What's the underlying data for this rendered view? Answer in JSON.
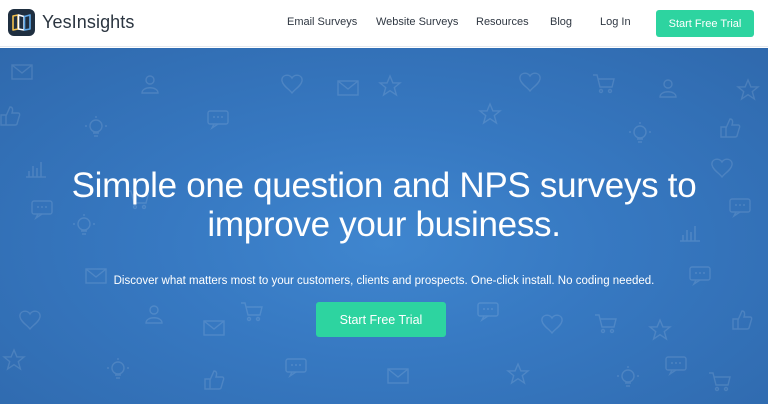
{
  "brand": {
    "name": "YesInsights",
    "logo_icon": "book-map-icon"
  },
  "nav": {
    "links": [
      {
        "label": "Email Surveys"
      },
      {
        "label": "Website Surveys"
      },
      {
        "label": "Resources"
      },
      {
        "label": "Blog"
      },
      {
        "label": "Log In"
      }
    ],
    "cta_label": "Start Free Trial"
  },
  "hero": {
    "title_line1": "Simple one question and NPS surveys to",
    "title_line2": "improve your business.",
    "subtitle": "Discover what matters most to your customers, clients and prospects. One-click install. No coding needed.",
    "cta_label": "Start Free Trial",
    "background_icons": [
      "heart-icon",
      "envelope-icon",
      "user-icon",
      "star-icon",
      "thumbs-up-icon",
      "lightbulb-icon",
      "chat-bubble-icon",
      "cart-icon",
      "chart-icon"
    ]
  },
  "colors": {
    "accent": "#2dd4a0",
    "hero_blue": "#3779c2",
    "nav_text": "#2f3742",
    "logo_bg": "#1f2f40"
  }
}
